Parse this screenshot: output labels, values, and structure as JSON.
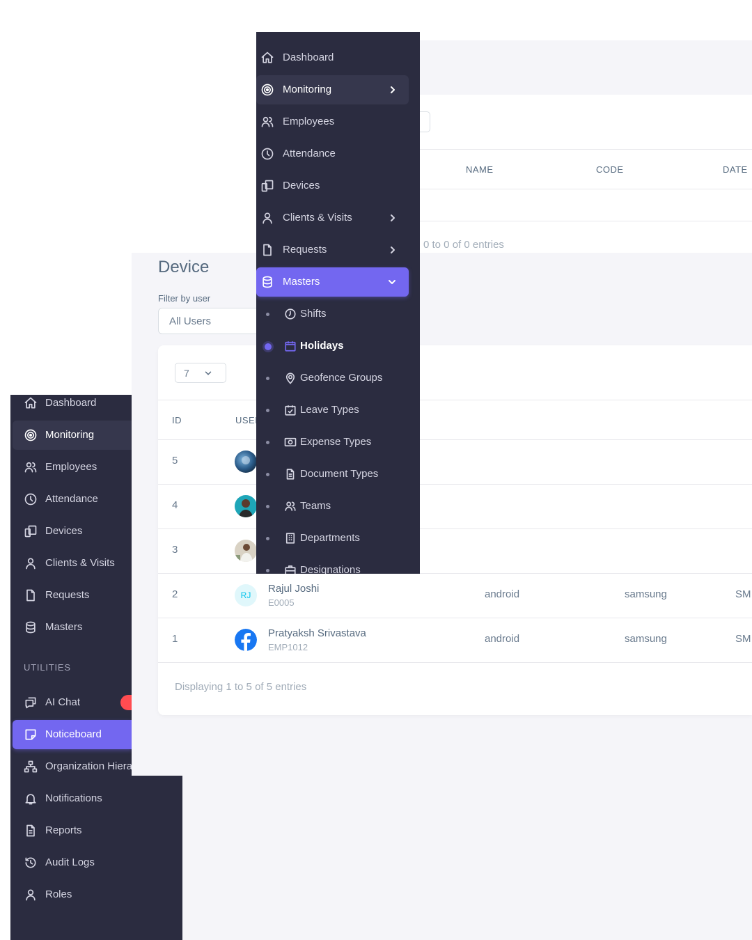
{
  "holiday_page": {
    "columns": [
      "NAME",
      "CODE",
      "DATE"
    ],
    "info": "0 to 0 of 0 entries"
  },
  "device_page": {
    "title": "Device",
    "filter_label": "Filter by user",
    "filter_value": "All Users",
    "page_length": "7",
    "columns": [
      "ID",
      "USER"
    ],
    "rows": [
      {
        "id": "5",
        "name": "",
        "code": "",
        "os": "",
        "brand": "",
        "model": "",
        "avatar": "photo-blue"
      },
      {
        "id": "4",
        "name": "",
        "code": "",
        "os": "",
        "brand": "",
        "model": "",
        "avatar": "photo-teal"
      },
      {
        "id": "3",
        "name": "",
        "code": "",
        "os": "",
        "brand": "",
        "model": "",
        "avatar": "photo-outdoor"
      },
      {
        "id": "2",
        "name": "Rajul Joshi",
        "code": "E0005",
        "os": "android",
        "brand": "samsung",
        "model": "SM",
        "avatar": "RJ"
      },
      {
        "id": "1",
        "name": "Pratyaksh Srivastava",
        "code": "EMP1012",
        "os": "android",
        "brand": "samsung",
        "model": "SM",
        "avatar": "facebook-icon"
      }
    ],
    "info": "Displaying 1 to 5 of 5 entries"
  },
  "sidebar_front": {
    "items": [
      {
        "label": "Dashboard",
        "icon": "home-icon"
      },
      {
        "label": "Monitoring",
        "icon": "target-icon",
        "state": "hover"
      },
      {
        "label": "Employees",
        "icon": "users-icon"
      },
      {
        "label": "Attendance",
        "icon": "clock-icon"
      },
      {
        "label": "Devices",
        "icon": "devices-icon"
      },
      {
        "label": "Clients & Visits",
        "icon": "user-icon"
      },
      {
        "label": "Requests",
        "icon": "file-icon"
      },
      {
        "label": "Masters",
        "icon": "database-icon",
        "state": "active-open"
      }
    ],
    "sub_items": [
      {
        "label": "Shifts",
        "icon": "clock-icon"
      },
      {
        "label": "Holidays",
        "icon": "calendar-icon",
        "current": true
      },
      {
        "label": "Geofence Groups",
        "icon": "map-pin-icon"
      },
      {
        "label": "Leave Types",
        "icon": "calendar-check-icon"
      },
      {
        "label": "Expense Types",
        "icon": "cash-icon"
      },
      {
        "label": "Document Types",
        "icon": "file-text-icon"
      },
      {
        "label": "Teams",
        "icon": "users-icon"
      },
      {
        "label": "Departments",
        "icon": "building-icon"
      },
      {
        "label": "Designations",
        "icon": "briefcase-icon"
      }
    ]
  },
  "sidebar_back": {
    "items": [
      {
        "label": "Dashboard",
        "icon": "home-icon"
      },
      {
        "label": "Monitoring",
        "icon": "target-icon",
        "state": "hover"
      },
      {
        "label": "Employees",
        "icon": "users-icon"
      },
      {
        "label": "Attendance",
        "icon": "clock-icon"
      },
      {
        "label": "Devices",
        "icon": "devices-icon"
      },
      {
        "label": "Clients & Visits",
        "icon": "user-icon"
      },
      {
        "label": "Requests",
        "icon": "file-icon"
      },
      {
        "label": "Masters",
        "icon": "database-icon"
      }
    ],
    "section_utilities": "UTILITIES",
    "utility_items": [
      {
        "label": "AI Chat",
        "icon": "chat-icon"
      },
      {
        "label": "Noticeboard",
        "icon": "sticky-note-icon",
        "state": "active"
      },
      {
        "label": "Organization Hierarchy",
        "icon": "sitemap-icon"
      },
      {
        "label": "Notifications",
        "icon": "bell-icon"
      },
      {
        "label": "Reports",
        "icon": "file-text-icon"
      },
      {
        "label": "Audit Logs",
        "icon": "history-icon"
      },
      {
        "label": "Roles",
        "icon": "user-icon"
      }
    ]
  },
  "colors": {
    "sidebar_bg": "#2b2c40",
    "accent": "#7367f0",
    "page_bg": "#f5f5f9",
    "badge": "#ff4c51"
  }
}
